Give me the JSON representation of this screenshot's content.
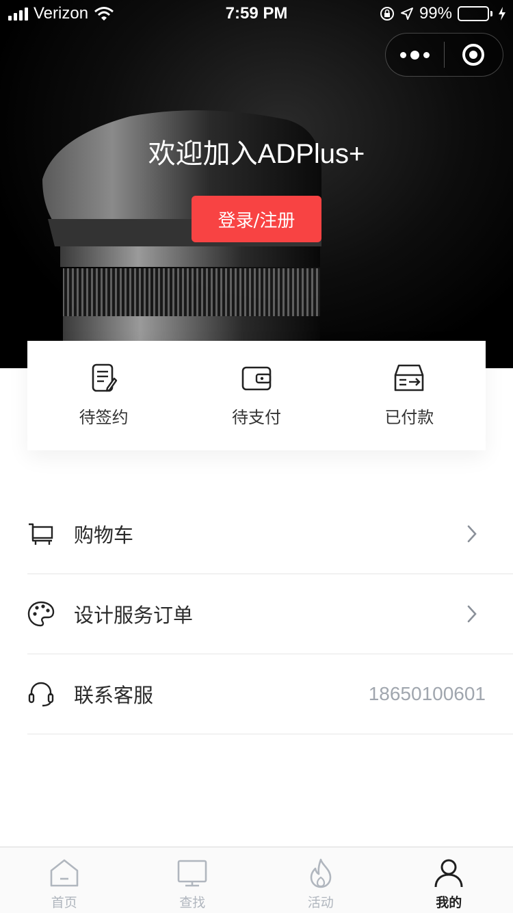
{
  "status_bar": {
    "carrier": "Verizon",
    "time": "7:59 PM",
    "battery": "99%",
    "battery_level": 0.99
  },
  "hero": {
    "welcome": "欢迎加入ADPlus+",
    "login_label": "登录/注册"
  },
  "orders": {
    "items": [
      {
        "label": "待签约",
        "icon": "contract-pen-icon"
      },
      {
        "label": "待支付",
        "icon": "wallet-icon"
      },
      {
        "label": "已付款",
        "icon": "paid-box-icon"
      }
    ]
  },
  "menu": {
    "cart_label": "购物车",
    "design_orders_label": "设计服务订单",
    "contact_label": "联系客服",
    "contact_phone": "18650100601"
  },
  "tabbar": {
    "tabs": [
      {
        "label": "首页",
        "icon": "home-icon"
      },
      {
        "label": "查找",
        "icon": "monitor-icon"
      },
      {
        "label": "活动",
        "icon": "flame-icon"
      },
      {
        "label": "我的",
        "icon": "user-icon"
      }
    ],
    "active_tab": "我的"
  },
  "colors": {
    "accent": "#f84343",
    "battery": "#4cd964",
    "muted": "#a0a6ae"
  }
}
